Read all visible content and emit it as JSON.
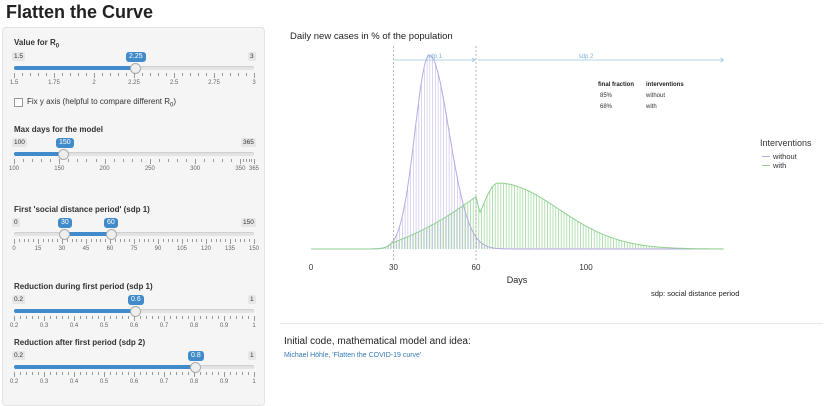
{
  "page": {
    "title": "Flatten the Curve"
  },
  "sidebar": {
    "r0": {
      "label_main": "Value for R",
      "label_sub": "0",
      "min": "1.5",
      "max": "3",
      "value": "2.25",
      "ticks": [
        "1.5",
        "1.75",
        "2",
        "2.25",
        "2.5",
        "2.75",
        "3"
      ]
    },
    "fix_axis": {
      "label_pre": "Fix y axis (helpful to compare different R",
      "label_sub": "0",
      "label_post": ")",
      "checked": false
    },
    "max_days": {
      "label": "Max days for the model",
      "min": "100",
      "max": "365",
      "value": "150",
      "ticks": [
        "100",
        "150",
        "200",
        "250",
        "300",
        "350",
        "365"
      ]
    },
    "sdp1": {
      "label": "First 'social distance period' (sdp 1)",
      "min": "0",
      "max": "150",
      "value_from": "30",
      "value_to": "60",
      "ticks": [
        "0",
        "15",
        "30",
        "45",
        "60",
        "75",
        "90",
        "105",
        "120",
        "135",
        "150"
      ]
    },
    "red1": {
      "label": "Reduction during first period (sdp 1)",
      "min": "0.2",
      "max": "1",
      "value": "0.6",
      "ticks": [
        "0.2",
        "0.3",
        "0.4",
        "0.5",
        "0.6",
        "0.7",
        "0.8",
        "0.9",
        "1"
      ]
    },
    "red2": {
      "label": "Reduction after first period (sdp 2)",
      "min": "0.2",
      "max": "1",
      "value": "0.8",
      "ticks": [
        "0.2",
        "0.3",
        "0.4",
        "0.5",
        "0.6",
        "0.7",
        "0.8",
        "0.9",
        "1"
      ]
    }
  },
  "main": {
    "section_heading": "Initial code, mathematical model and idea:",
    "link_text": "Michael Höhle, 'Flatten the COVID-19 curve'"
  },
  "chart_data": {
    "type": "line",
    "title": "Daily new cases in % of the population",
    "xlabel": "Days",
    "x_ticks": [
      "0",
      "30",
      "60",
      "100"
    ],
    "xlim": [
      0,
      150
    ],
    "caption": "sdp: social distance period",
    "periods": [
      {
        "label": "sdp 1",
        "from": 30,
        "to": 60
      },
      {
        "label": "sdp 2",
        "from": 60,
        "to": 150
      }
    ],
    "legend": {
      "title": "Interventions",
      "entries": [
        {
          "name": "without",
          "color": "#b7a9e3"
        },
        {
          "name": "with",
          "color": "#8fd28f"
        }
      ]
    },
    "table": {
      "headers": [
        "final fraction",
        "interventions"
      ],
      "rows": [
        [
          "85%",
          "without"
        ],
        [
          "68%",
          "with"
        ]
      ]
    },
    "series": [
      {
        "name": "without",
        "color": "#b7a9e3",
        "peak_day": 43,
        "peak_value": 1.0
      },
      {
        "name": "with",
        "color": "#8fd28f",
        "peak_day": 68,
        "peak_value": 0.34
      }
    ]
  }
}
